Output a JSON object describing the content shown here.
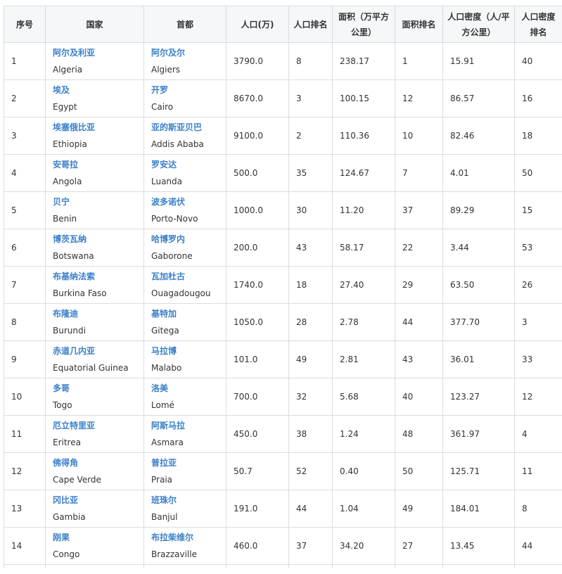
{
  "columns": [
    "序号",
    "国家",
    "首都",
    "人口(万)",
    "人口排名",
    "面积（万平方公里）",
    "面积排名",
    "人口密度（人/平方公里）",
    "人口密度排名"
  ],
  "rows": [
    {
      "idx": "1",
      "country_zh": "阿尔及利亚",
      "country_en": "Algeria",
      "capital_zh": "阿尔及尔",
      "capital_en": "Algiers",
      "pop": "3790.0",
      "pop_rank": "8",
      "area": "238.17",
      "area_rank": "1",
      "density": "15.91",
      "density_rank": "40"
    },
    {
      "idx": "2",
      "country_zh": "埃及",
      "country_en": "Egypt",
      "capital_zh": "开罗",
      "capital_en": "Cairo",
      "pop": "8670.0",
      "pop_rank": "3",
      "area": "100.15",
      "area_rank": "12",
      "density": "86.57",
      "density_rank": "16"
    },
    {
      "idx": "3",
      "country_zh": "埃塞俄比亚",
      "country_en": "Ethiopia",
      "capital_zh": "亚的斯亚贝巴",
      "capital_en": "Addis Ababa",
      "pop": "9100.0",
      "pop_rank": "2",
      "area": "110.36",
      "area_rank": "10",
      "density": "82.46",
      "density_rank": "18"
    },
    {
      "idx": "4",
      "country_zh": "安哥拉",
      "country_en": "Angola",
      "capital_zh": "罗安达",
      "capital_en": "Luanda",
      "pop": "500.0",
      "pop_rank": "35",
      "area": "124.67",
      "area_rank": "7",
      "density": "4.01",
      "density_rank": "50"
    },
    {
      "idx": "5",
      "country_zh": "贝宁",
      "country_en": "Benin",
      "capital_zh": "波多诺伏",
      "capital_en": "Porto-Novo",
      "pop": "1000.0",
      "pop_rank": "30",
      "area": "11.20",
      "area_rank": "37",
      "density": "89.29",
      "density_rank": "15"
    },
    {
      "idx": "6",
      "country_zh": "博茨瓦纳",
      "country_en": "Botswana",
      "capital_zh": "哈博罗内",
      "capital_en": "Gaborone",
      "pop": "200.0",
      "pop_rank": "43",
      "area": "58.17",
      "area_rank": "22",
      "density": "3.44",
      "density_rank": "53"
    },
    {
      "idx": "7",
      "country_zh": "布基纳法索",
      "country_en": "Burkina Faso",
      "capital_zh": "瓦加杜古",
      "capital_en": "Ouagadougou",
      "pop": "1740.0",
      "pop_rank": "18",
      "area": "27.40",
      "area_rank": "29",
      "density": "63.50",
      "density_rank": "26"
    },
    {
      "idx": "8",
      "country_zh": "布隆迪",
      "country_en": "Burundi",
      "capital_zh": "基特加",
      "capital_en": "Gitega",
      "pop": "1050.0",
      "pop_rank": "28",
      "area": "2.78",
      "area_rank": "44",
      "density": "377.70",
      "density_rank": "3"
    },
    {
      "idx": "9",
      "country_zh": "赤道几内亚",
      "country_en": "Equatorial Guinea",
      "capital_zh": "马拉博",
      "capital_en": "Malabo",
      "pop": "101.0",
      "pop_rank": "49",
      "area": "2.81",
      "area_rank": "43",
      "density": "36.01",
      "density_rank": "33"
    },
    {
      "idx": "10",
      "country_zh": "多哥",
      "country_en": "Togo",
      "capital_zh": "洛美",
      "capital_en": "Lomé",
      "pop": "700.0",
      "pop_rank": "32",
      "area": "5.68",
      "area_rank": "40",
      "density": "123.27",
      "density_rank": "12"
    },
    {
      "idx": "11",
      "country_zh": "厄立特里亚",
      "country_en": "Eritrea",
      "capital_zh": "阿斯马拉",
      "capital_en": "Asmara",
      "pop": "450.0",
      "pop_rank": "38",
      "area": "1.24",
      "area_rank": "48",
      "density": "361.97",
      "density_rank": "4"
    },
    {
      "idx": "12",
      "country_zh": "佛得角",
      "country_en": "Cape Verde",
      "capital_zh": "普拉亚",
      "capital_en": "Praia",
      "pop": "50.7",
      "pop_rank": "52",
      "area": "0.40",
      "area_rank": "50",
      "density": "125.71",
      "density_rank": "11"
    },
    {
      "idx": "13",
      "country_zh": "冈比亚",
      "country_en": "Gambia",
      "capital_zh": "班珠尔",
      "capital_en": "Banjul",
      "pop": "191.0",
      "pop_rank": "44",
      "area": "1.04",
      "area_rank": "49",
      "density": "184.01",
      "density_rank": "8"
    },
    {
      "idx": "14",
      "country_zh": "刚果",
      "country_en": "Congo",
      "capital_zh": "布拉柴维尔",
      "capital_en": "Brazzaville",
      "pop": "460.0",
      "pop_rank": "37",
      "area": "34.20",
      "area_rank": "27",
      "density": "13.45",
      "density_rank": "44"
    }
  ],
  "colors": {
    "link": "#3a7fc9",
    "header_bg": "#f5f7fa",
    "border": "#dcdcdc",
    "text": "#333333"
  }
}
